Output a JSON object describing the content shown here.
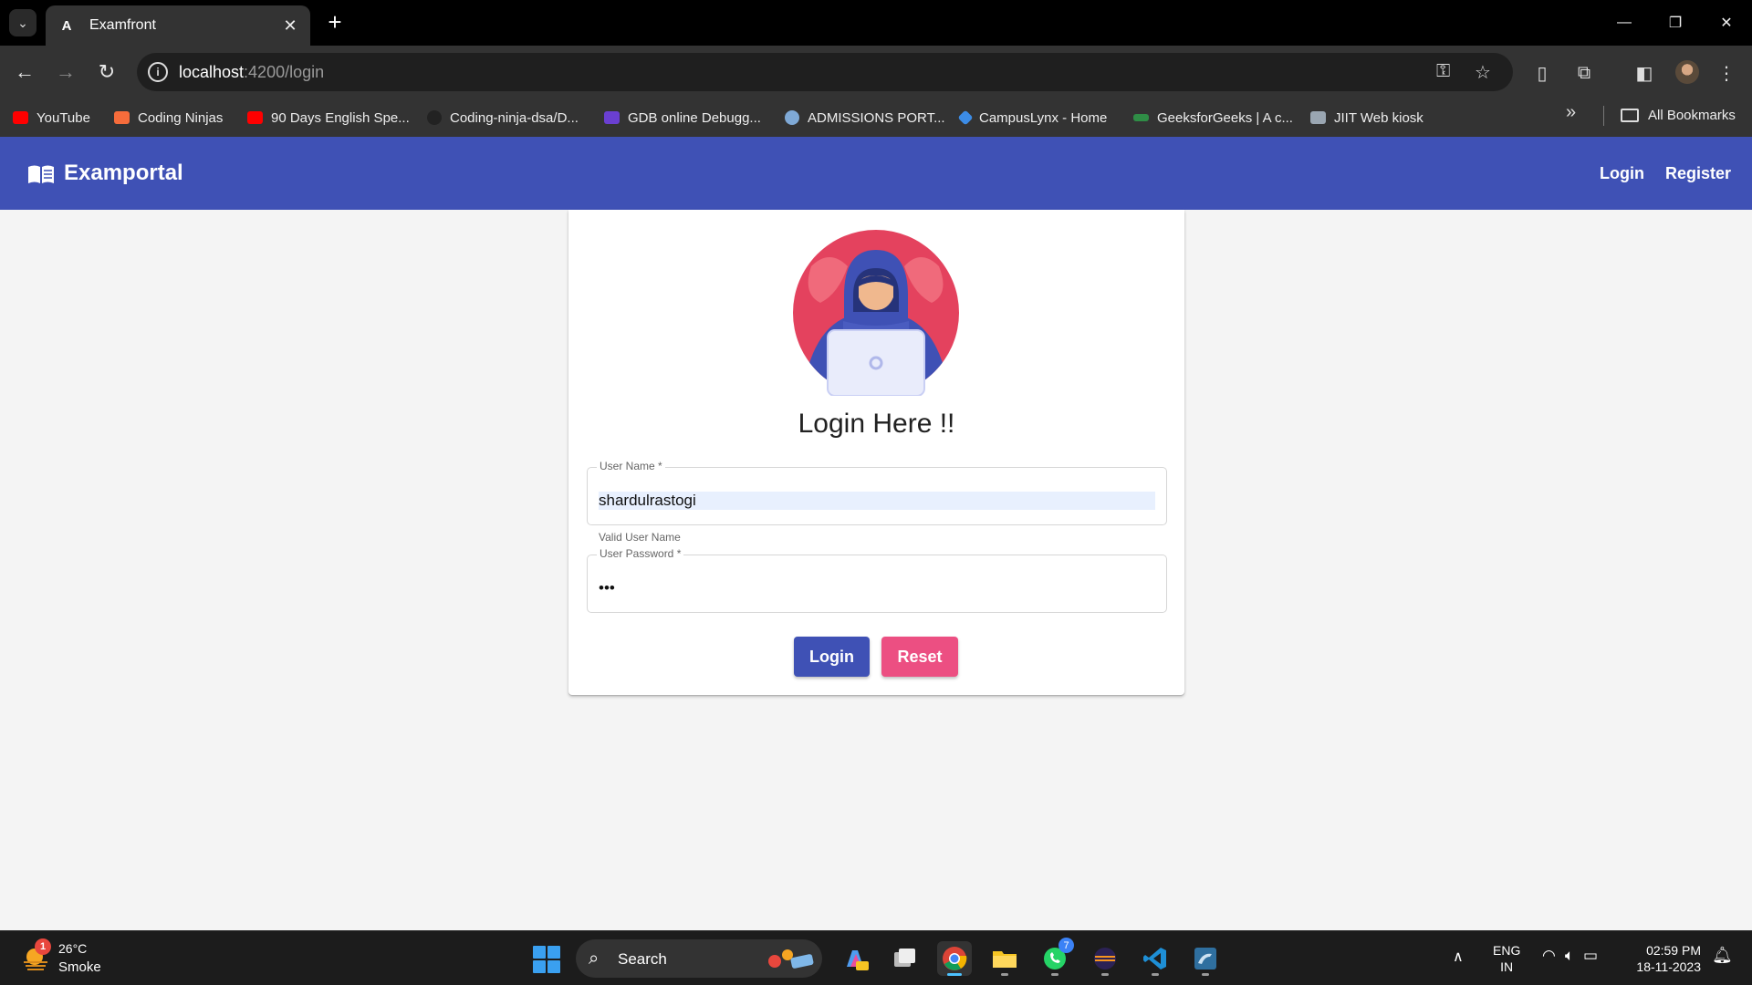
{
  "browser": {
    "tab_title": "Examfront",
    "url_host": "localhost",
    "url_path": ":4200/login",
    "bookmarks": [
      {
        "label": "YouTube",
        "icon": "youtube-icon",
        "color": "#ff0000"
      },
      {
        "label": "Coding Ninjas",
        "icon": "coding-ninjas-icon",
        "color": "#f66c3b"
      },
      {
        "label": "90 Days English Spe...",
        "icon": "youtube-icon",
        "color": "#ff0000"
      },
      {
        "label": "Coding-ninja-dsa/D...",
        "icon": "github-icon",
        "color": "#111111"
      },
      {
        "label": "GDB online Debugg...",
        "icon": "gdb-icon",
        "color": "#6a3fd1"
      },
      {
        "label": "ADMISSIONS PORT...",
        "icon": "globe-icon",
        "color": "#7fa9d6"
      },
      {
        "label": "CampusLynx - Home",
        "icon": "campuslynx-icon",
        "color": "#3c8ce6"
      },
      {
        "label": "GeeksforGeeks | A c...",
        "icon": "geeksforgeeks-icon",
        "color": "#2f8d46"
      },
      {
        "label": "JIIT Web kiosk",
        "icon": "jiit-icon",
        "color": "#9aa6b2"
      }
    ],
    "all_bookmarks_label": "All Bookmarks"
  },
  "app": {
    "brand": "Examportal",
    "nav": {
      "login": "Login",
      "register": "Register"
    },
    "primary_color": "#3f51b5",
    "accent_color": "#ec4f82"
  },
  "login_form": {
    "title": "Login Here !!",
    "username": {
      "label": "User Name *",
      "value": "shardulrastogi",
      "hint": "Valid User Name"
    },
    "password": {
      "label": "User Password *",
      "value": "abc"
    },
    "login_button": "Login",
    "reset_button": "Reset"
  },
  "taskbar": {
    "weather": {
      "temp": "26°C",
      "desc": "Smoke",
      "badge": "1"
    },
    "search_label": "Search",
    "whatsapp_badge": "7",
    "lang_top": "ENG",
    "lang_bottom": "IN",
    "time": "02:59 PM",
    "date": "18-11-2023"
  }
}
